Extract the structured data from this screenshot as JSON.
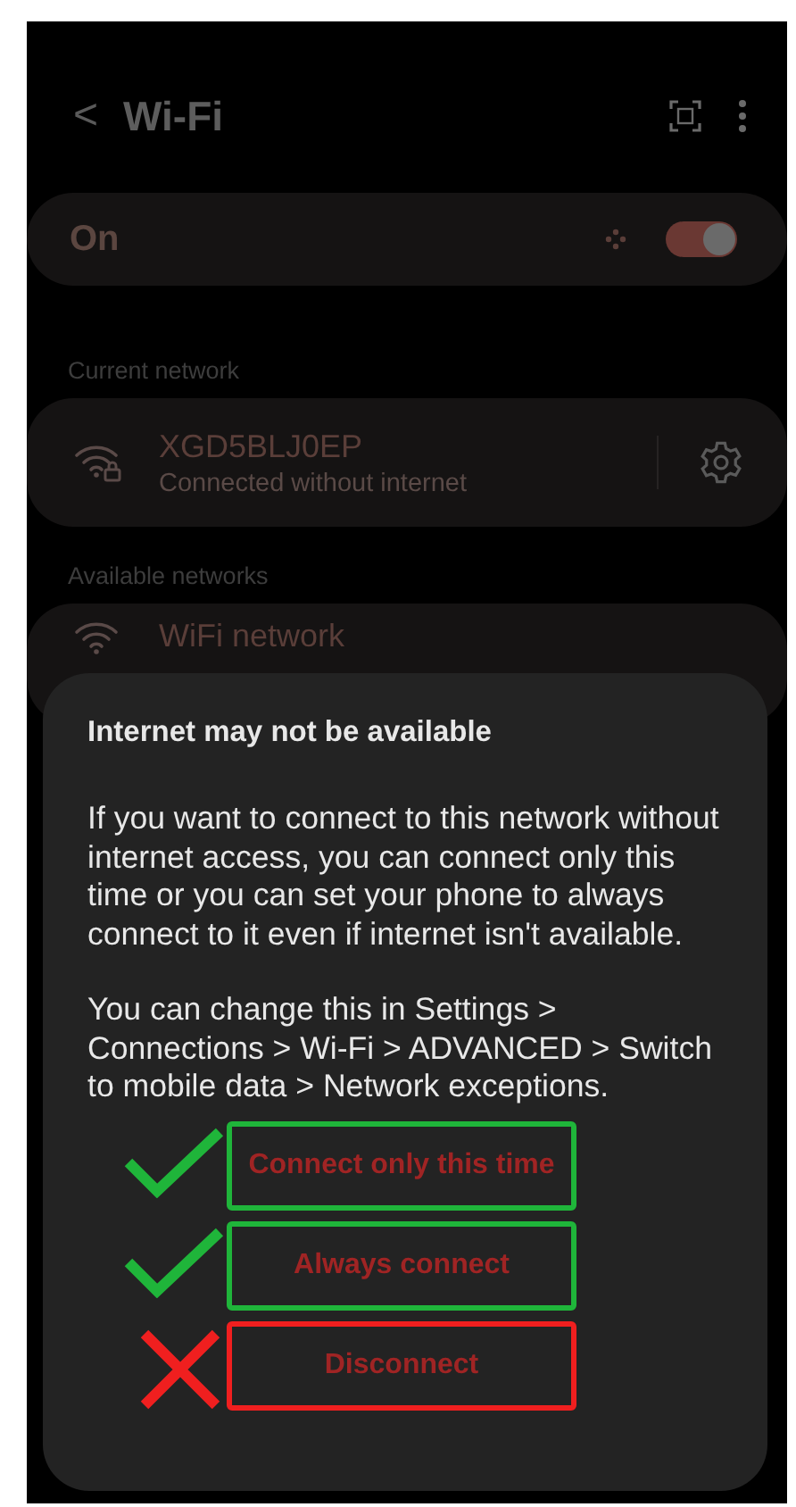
{
  "header": {
    "back": "<",
    "title": "Wi-Fi"
  },
  "master": {
    "label": "On",
    "on": true
  },
  "current": {
    "heading": "Current network",
    "network": {
      "name": "XGD5BLJ0EP",
      "status": "Connected without internet"
    }
  },
  "available": {
    "heading": "Available networks",
    "networks": [
      {
        "name": "WiFi network"
      }
    ]
  },
  "dialog": {
    "title": "Internet may not be available",
    "paragraphs": [
      "If you want to connect to this network without internet access, you can connect only this time or you can set your phone to always connect to it even if internet isn't available.",
      "You can change this in Settings > Connections > Wi-Fi > ADVANCED > Switch to mobile data > Network exceptions."
    ],
    "options": [
      {
        "label": "Connect only this time",
        "kind": "check",
        "color": "#1fb53a"
      },
      {
        "label": "Always connect",
        "kind": "check",
        "color": "#1fb53a"
      },
      {
        "label": "Disconnect",
        "kind": "cross",
        "color": "#f01f1f"
      }
    ]
  }
}
